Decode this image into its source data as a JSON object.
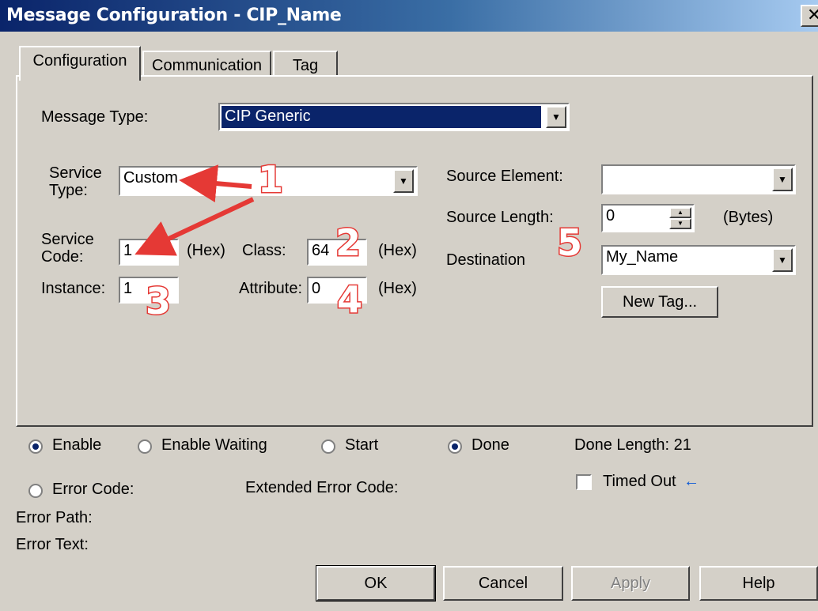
{
  "window": {
    "title": "Message Configuration - CIP_Name",
    "close_glyph": "✕"
  },
  "tabs": [
    "Configuration",
    "Communication",
    "Tag"
  ],
  "config": {
    "message_type_label": "Message Type:",
    "message_type_value": "CIP Generic",
    "service_type_label_1": "Service",
    "service_type_label_2": "Type:",
    "service_type_value": "Custom",
    "service_code_label_1": "Service",
    "service_code_label_2": "Code:",
    "service_code_value": "1",
    "hex_1": "(Hex)",
    "class_label": "Class:",
    "class_value": "64",
    "hex_2": "(Hex)",
    "instance_label": "Instance:",
    "instance_value": "1",
    "attribute_label": "Attribute:",
    "attribute_value": "0",
    "hex_3": "(Hex)",
    "source_element_label": "Source Element:",
    "source_element_value": "",
    "source_length_label": "Source Length:",
    "source_length_value": "0",
    "bytes_label": "(Bytes)",
    "destination_label": "Destination",
    "destination_value": "My_Name",
    "new_tag_label": "New Tag..."
  },
  "status": {
    "enable": "Enable",
    "enable_waiting": "Enable Waiting",
    "start": "Start",
    "done": "Done",
    "done_length": "Done Length: 21",
    "error_code": "Error Code:",
    "extended_error_code": "Extended Error Code:",
    "timed_out": "Timed Out",
    "error_path": "Error Path:",
    "error_text": "Error Text:"
  },
  "buttons": {
    "ok": "OK",
    "cancel": "Cancel",
    "apply": "Apply",
    "help": "Help"
  },
  "annotations": [
    "1",
    "2",
    "3",
    "4",
    "5"
  ],
  "colors": {
    "annotation": "#e53935",
    "selection": "#0a246a"
  }
}
